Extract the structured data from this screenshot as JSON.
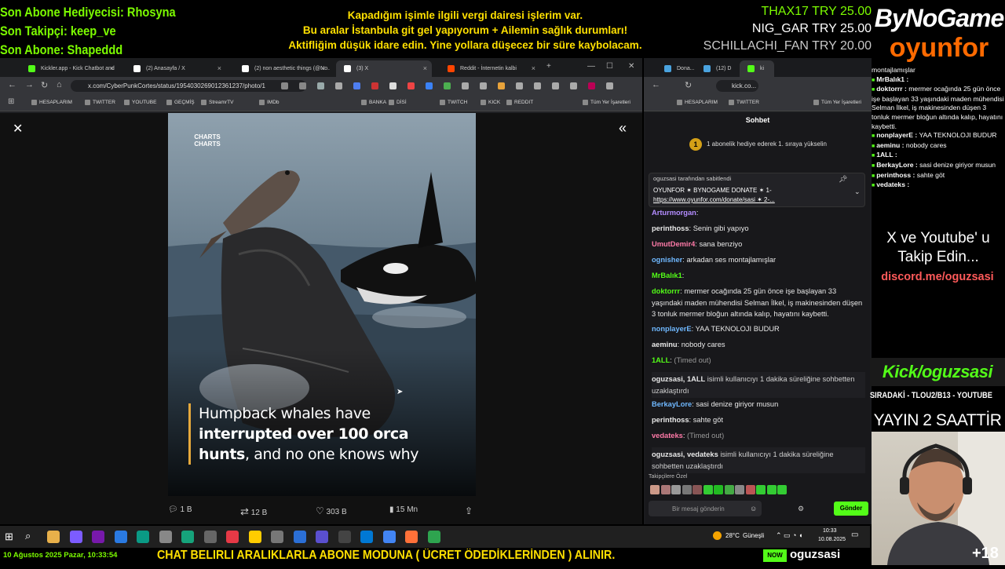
{
  "overlay": {
    "last_gifter": "Son Abone Hediyecisi: Rhosyna",
    "last_follower": "Son Takipçi: keep_ve",
    "last_sub": "Son Abone: Shapeddd",
    "announcement": [
      "Kapadığım işimle ilgili vergi dairesi işlerim var.",
      "Bu aralar İstanbula git gel yapıyorum + Ailemin sağlık durumları!",
      "Aktifliğim düşük idare edin. Yine yollara düşecez bir süre kaybolacam."
    ],
    "donations": [
      {
        "name": "THAX17",
        "amount": "TRY 25.00",
        "color": "#7CFC00"
      },
      {
        "name": "NIG_GAR",
        "amount": "TRY 25.00",
        "color": "#ffffff"
      },
      {
        "name": "SCHILLACHI_FAN",
        "amount": "TRY 20.00",
        "color": "#c8c8c8"
      }
    ],
    "brand_top": "ByNoGame",
    "brand_bottom": "oyunfor",
    "social_line1": "X ve Youtube' u",
    "social_line2": "Takip Edin...",
    "discord": "discord.me/oguzsasi",
    "kick": "Kick/oguzsasi",
    "siradaki": "SIRADAKİ - TLOU2/B13 - YOUTUBE",
    "yayin": "YAYIN 2 SAATTİR",
    "bottom_date": "10 Ağustos 2025 Pazar, 10:33:54",
    "bottom_message": "CHAT BELIRLI ARALIKLARLA ABONE MODUNA ( ÜCRET ÖDEDİKLERİNDEN ) ALINIR.",
    "bottom_kick": "NOW",
    "bottom_name": "oguzsasi",
    "viewer_extra": "+18",
    "colors": {
      "green": "#7CFC00",
      "yellow": "#FFE000",
      "orange": "#FF6A00",
      "kick": "#53FC18"
    }
  },
  "browser": {
    "tabs": [
      {
        "label": "Kickler.app - Kick Chatbot and",
        "icon": "kick-icon",
        "active": false
      },
      {
        "label": "(2) Anasayfa / X",
        "icon": "x-icon",
        "active": false
      },
      {
        "label": "(2) non aesthetic things (@No...",
        "icon": "x-icon",
        "active": false
      },
      {
        "label": "(3) X",
        "icon": "x-icon",
        "active": true
      },
      {
        "label": "Reddit - İnternetin kalbi",
        "icon": "reddit-icon",
        "active": false
      }
    ],
    "url": "x.com/CyberPunkCortes/status/1954030269012361237/photo/1",
    "bookmarks": [
      "HESAPLARIM",
      "TWITTER",
      "YOUTUBE",
      "GEÇMİŞ",
      "StreamrTV",
      "IMDb",
      "BANKA",
      "DİSİ",
      "TWITCH",
      "KICK",
      "REDDIT"
    ],
    "bookmarks_all": "Tüm Yer İşaretleri",
    "photo_watermark": "CHARTS CHARTS",
    "caption_plain": "Humpback whales have",
    "caption_bold1": "interrupted over 100 orca",
    "caption_bold2": "hunts",
    "caption_tail": ", and no one knows why",
    "actions": {
      "replies": "1 B",
      "reposts": "12 B",
      "likes": "303 B",
      "views": "15 Mn"
    }
  },
  "chat": {
    "tabs": [
      "Dona...",
      "(12) D",
      "ki"
    ],
    "url": "kick.co...",
    "bookmarks": [
      "HESAPLARIM",
      "TWITTER",
      "Tüm Yer İşaretleri"
    ],
    "title": "Sohbet",
    "goal": "1 abonelik hediye ederek 1. sıraya yükselin",
    "goal_rank": "1",
    "pinned_by": "oguzsasi tarafından sabitlendi",
    "pinned_text": "OYUNFOR ✶ BYNOGAME DONATE ✶ 1-",
    "pinned_link": "https://www.oyunfor.com/donate/sasi ✶ 2-...",
    "messages": [
      {
        "user": "Arturmorgan",
        "text": "",
        "color": "#b38cff"
      },
      {
        "user": "perinthoss",
        "text": "Senin gibi yapıyo",
        "color": "#e8e8e8"
      },
      {
        "user": "UmutDemir4",
        "text": "sana benziyo",
        "color": "#ff7aa8"
      },
      {
        "user": "ognisher",
        "text": "arkadan ses montajlamışlar",
        "color": "#6fb8ff"
      },
      {
        "user": "MrBalık1",
        "text": "",
        "color": "#53FC18"
      },
      {
        "user": "doktorrr",
        "text": "mermer ocağında 25 gün önce işe başlayan 33 yaşındaki maden mühendisi Selman İlkel, iş makinesinden düşen 3 tonluk mermer bloğun altında kalıp, hayatını kaybetti.",
        "color": "#53FC18"
      },
      {
        "user": "nonplayerE",
        "text": "YAA TEKNOLOJI BUDUR",
        "color": "#6fb8ff"
      },
      {
        "user": "aeminu",
        "text": "nobody cares",
        "color": "#e8e8e8"
      },
      {
        "user": "1ALL",
        "text": "(Timed out)",
        "color": "#53FC18"
      },
      {
        "user": "oguzsasi, 1ALL",
        "text": "isimli kullanıcıyı 1 dakika süreliğine sohbetten uzaklaştırdı",
        "color": "#e8e8e8"
      },
      {
        "user": "BerkayLore",
        "text": "sasi denize giriyor musun",
        "color": "#6fb8ff"
      },
      {
        "user": "perinthoss",
        "text": "sahte göt",
        "color": "#e8e8e8"
      },
      {
        "user": "vedateks",
        "text": "(Timed out)",
        "color": "#ff7aa8"
      },
      {
        "user": "oguzsasi, vedateks",
        "text": "isimli kullanıcıyı 1 dakika süreliğine sohbetten uzaklaştırdı",
        "color": "#e8e8e8"
      }
    ],
    "emotes_label": "Takipçilere Özel",
    "input_placeholder": "Bir mesaj gönderin",
    "send": "Gönder"
  },
  "right_chat": [
    {
      "user": "",
      "text": "montajlamışlar"
    },
    {
      "user": "MrBalık1 :",
      "text": ""
    },
    {
      "user": "doktorrr :",
      "text": "mermer ocağında 25 gün önce işe başlayan 33 yaşındaki maden mühendisi Selman İlkel, iş makinesinden düşen 3 tonluk mermer bloğun altında kalıp, hayatını kaybetti."
    },
    {
      "user": "nonplayerE :",
      "text": "YAA TEKNOLOJI BUDUR"
    },
    {
      "user": "aeminu :",
      "text": "nobody cares"
    },
    {
      "user": "1ALL :",
      "text": ""
    },
    {
      "user": "BerkayLore :",
      "text": "sasi denize giriyor musun"
    },
    {
      "user": "perinthoss :",
      "text": "sahte göt"
    },
    {
      "user": "vedateks :",
      "text": ""
    }
  ],
  "taskbar": {
    "weather": "28°C",
    "weather_desc": "Güneşli",
    "time": "10:33",
    "date": "10.08.2025"
  }
}
